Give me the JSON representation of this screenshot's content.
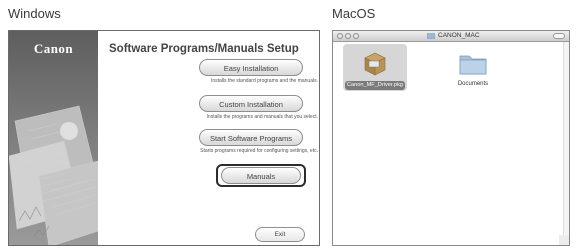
{
  "labels": {
    "windows": "Windows",
    "macos": "MacOS"
  },
  "windows_installer": {
    "brand": "Canon",
    "title": "Software Programs/Manuals Setup",
    "buttons": [
      {
        "label": "Easy Installation",
        "description": "Installs the standard programs and the manuals."
      },
      {
        "label": "Custom Installation",
        "description": "Installs the programs and manuals that you select."
      },
      {
        "label": "Start Software Programs",
        "description": "Starts programs required for configuring settings, etc."
      },
      {
        "label": "Manuals",
        "description": ""
      }
    ],
    "exit_label": "Exit",
    "highlighted": "Manuals"
  },
  "mac_finder": {
    "title": "CANON_MAC",
    "items": [
      {
        "name": "Canon_MF_Driver.pkg",
        "icon": "package-icon",
        "selected": true
      },
      {
        "name": "Documents",
        "icon": "folder-icon",
        "selected": false
      }
    ]
  },
  "colors": {
    "highlight_border": "#2c2c2c",
    "selection": "#d6d6d6"
  }
}
